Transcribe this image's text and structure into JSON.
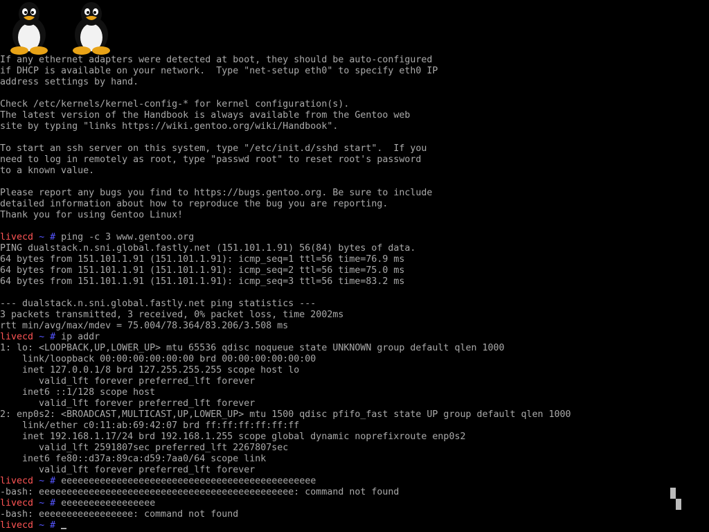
{
  "logos": [
    {
      "icon": "tux-penguin-icon"
    },
    {
      "icon": "tux-penguin-icon"
    }
  ],
  "prompt": {
    "host": "livecd",
    "path": "~",
    "symbol": "#"
  },
  "colors": {
    "background": "#000000",
    "text": "#aaaaaa",
    "host": "#ff5555",
    "path": "#5555ff"
  },
  "lines": [
    {
      "text": "If any ethernet adapters were detected at boot, they should be auto-configured"
    },
    {
      "text": "if DHCP is available on your network.  Type \"net-setup eth0\" to specify eth0 IP"
    },
    {
      "text": "address settings by hand."
    },
    {
      "text": ""
    },
    {
      "text": "Check /etc/kernels/kernel-config-* for kernel configuration(s)."
    },
    {
      "text": "The latest version of the Handbook is always available from the Gentoo web"
    },
    {
      "text": "site by typing \"links https://wiki.gentoo.org/wiki/Handbook\"."
    },
    {
      "text": ""
    },
    {
      "text": "To start an ssh server on this system, type \"/etc/init.d/sshd start\".  If you"
    },
    {
      "text": "need to log in remotely as root, type \"passwd root\" to reset root's password"
    },
    {
      "text": "to a known value."
    },
    {
      "text": ""
    },
    {
      "text": "Please report any bugs you find to https://bugs.gentoo.org. Be sure to include"
    },
    {
      "text": "detailed information about how to reproduce the bug you are reporting."
    },
    {
      "text": "Thank you for using Gentoo Linux!"
    },
    {
      "text": ""
    },
    {
      "prompt": true,
      "text": "ping -c 3 www.gentoo.org"
    },
    {
      "text": "PING dualstack.n.sni.global.fastly.net (151.101.1.91) 56(84) bytes of data."
    },
    {
      "text": "64 bytes from 151.101.1.91 (151.101.1.91): icmp_seq=1 ttl=56 time=76.9 ms"
    },
    {
      "text": "64 bytes from 151.101.1.91 (151.101.1.91): icmp_seq=2 ttl=56 time=75.0 ms"
    },
    {
      "text": "64 bytes from 151.101.1.91 (151.101.1.91): icmp_seq=3 ttl=56 time=83.2 ms"
    },
    {
      "text": ""
    },
    {
      "text": "--- dualstack.n.sni.global.fastly.net ping statistics ---"
    },
    {
      "text": "3 packets transmitted, 3 received, 0% packet loss, time 2002ms"
    },
    {
      "text": "rtt min/avg/max/mdev = 75.004/78.364/83.206/3.508 ms"
    },
    {
      "prompt": true,
      "text": "ip addr"
    },
    {
      "text": "1: lo: <LOOPBACK,UP,LOWER_UP> mtu 65536 qdisc noqueue state UNKNOWN group default qlen 1000"
    },
    {
      "text": "    link/loopback 00:00:00:00:00:00 brd 00:00:00:00:00:00"
    },
    {
      "text": "    inet 127.0.0.1/8 brd 127.255.255.255 scope host lo"
    },
    {
      "text": "       valid_lft forever preferred_lft forever"
    },
    {
      "text": "    inet6 ::1/128 scope host"
    },
    {
      "text": "       valid_lft forever preferred_lft forever"
    },
    {
      "text": "2: enp0s2: <BROADCAST,MULTICAST,UP,LOWER_UP> mtu 1500 qdisc pfifo_fast state UP group default qlen 1000"
    },
    {
      "text": "    link/ether c0:11:ab:69:42:07 brd ff:ff:ff:ff:ff:ff"
    },
    {
      "text": "    inet 192.168.1.17/24 brd 192.168.1.255 scope global dynamic noprefixroute enp0s2"
    },
    {
      "text": "       valid_lft 2591807sec preferred_lft 2267807sec"
    },
    {
      "text": "    inet6 fe80::d37a:89ca:d59:7aa0/64 scope link"
    },
    {
      "text": "       valid_lft forever preferred_lft forever"
    },
    {
      "prompt": true,
      "text": "eeeeeeeeeeeeeeeeeeeeeeeeeeeeeeeeeeeeeeeeeeeeee"
    },
    {
      "text": "-bash: eeeeeeeeeeeeeeeeeeeeeeeeeeeeeeeeeeeeeeeeeeeeee: command not found"
    },
    {
      "prompt": true,
      "text": "eeeeeeeeeeeeeeeee"
    },
    {
      "text": "-bash: eeeeeeeeeeeeeeeee: command not found"
    },
    {
      "prompt": true,
      "text": "",
      "cursor": true
    }
  ]
}
